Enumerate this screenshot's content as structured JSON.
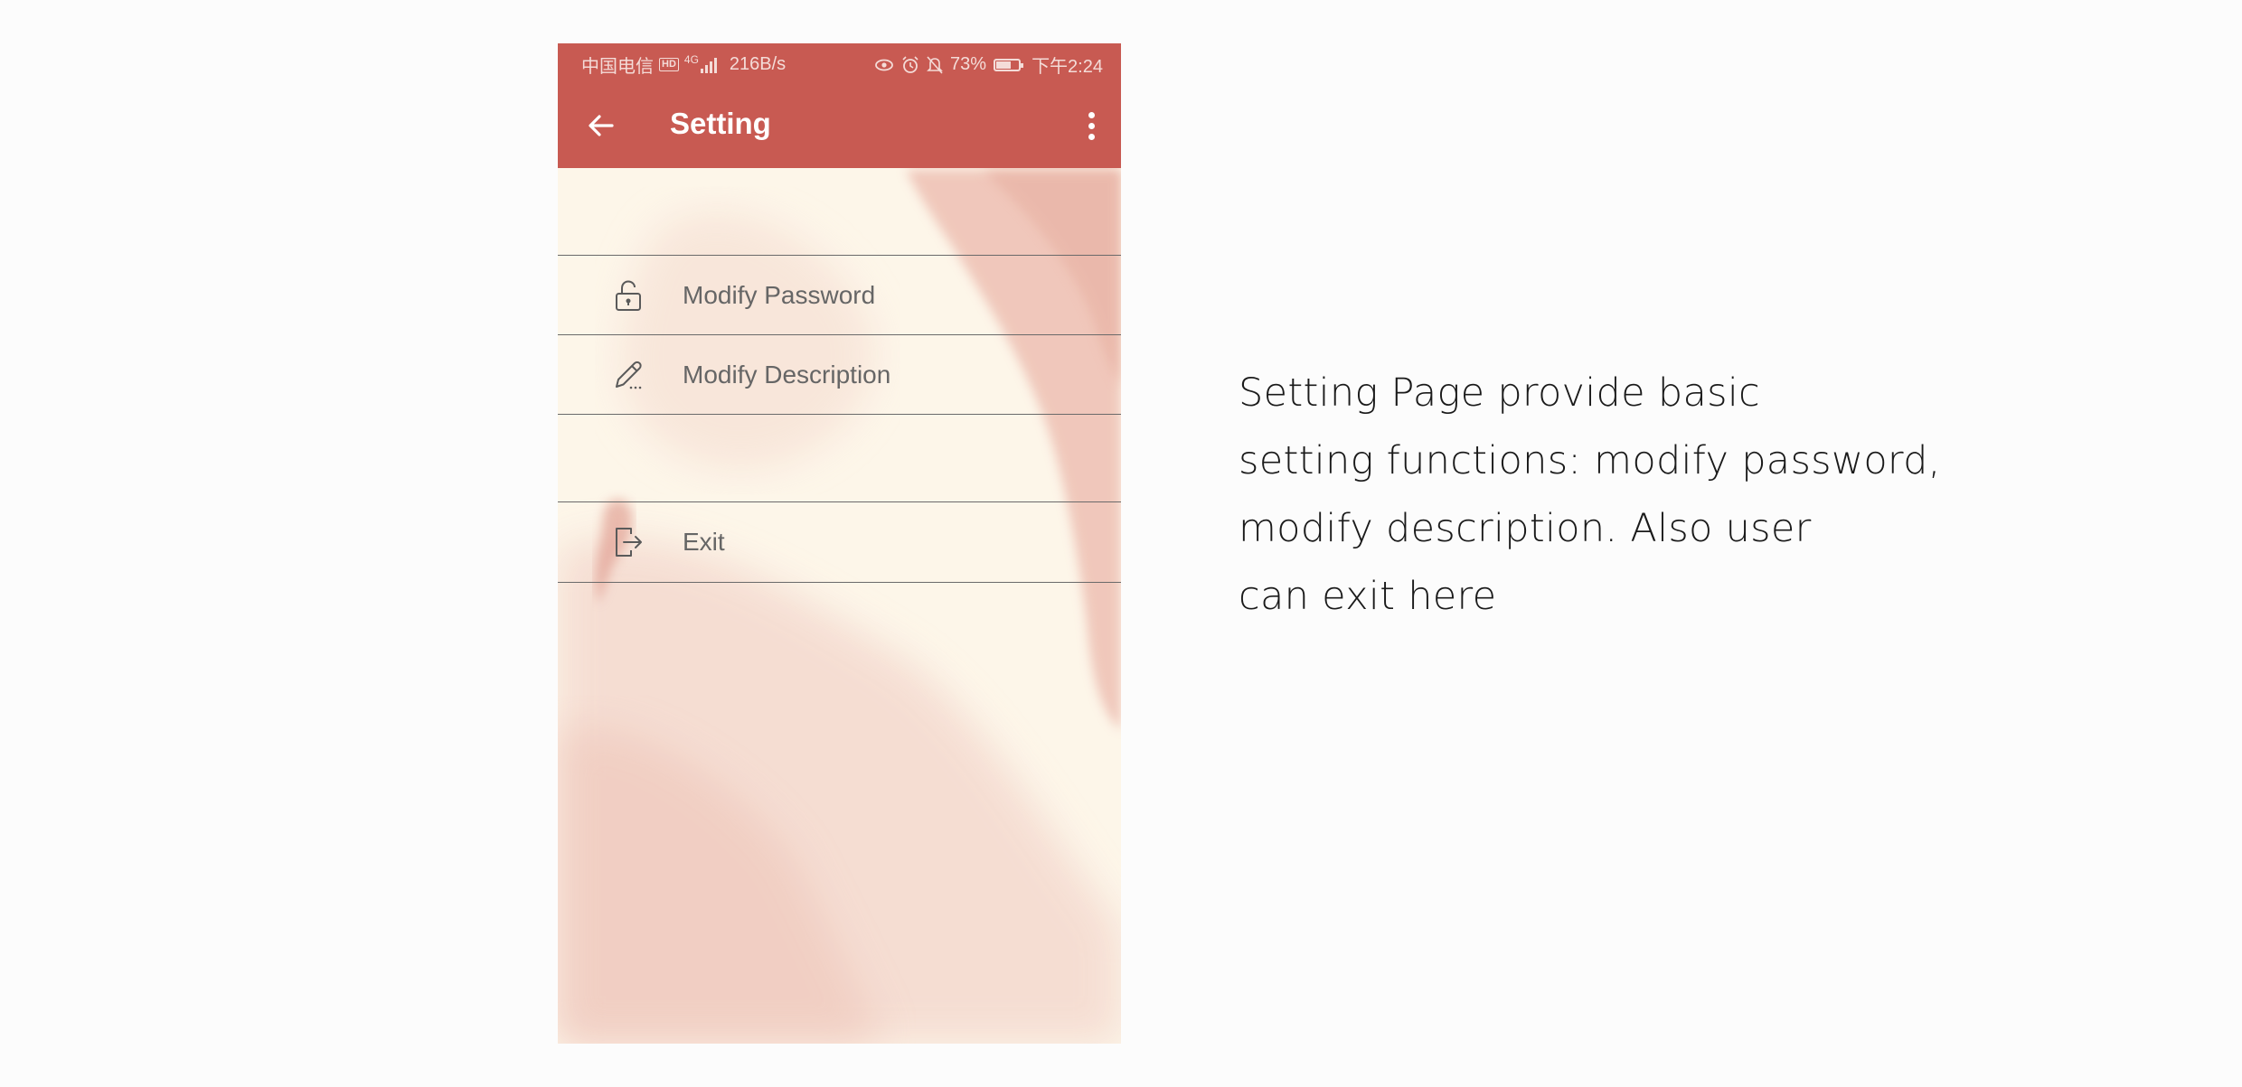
{
  "status_bar": {
    "carrier": "中国电信",
    "hd": "HD",
    "network": "4G",
    "speed": "216B/s",
    "battery": "73%",
    "battery_level": 0.73,
    "time": "下午2:24"
  },
  "app_bar": {
    "title": "Setting"
  },
  "menu": {
    "items": [
      {
        "label": "Modify Password",
        "icon": "lock-open-icon"
      },
      {
        "label": "Modify Description",
        "icon": "pencil-icon"
      },
      {
        "label": "Exit",
        "icon": "exit-icon"
      }
    ]
  },
  "caption": {
    "lines": [
      "Setting Page provide basic",
      "setting functions: modify password,",
      "modify description. Also user",
      "can exit here"
    ]
  },
  "colors": {
    "primary": "#c85a52",
    "background": "#fdf6ea",
    "divider": "#6a6a6a",
    "text_secondary": "#666666"
  }
}
